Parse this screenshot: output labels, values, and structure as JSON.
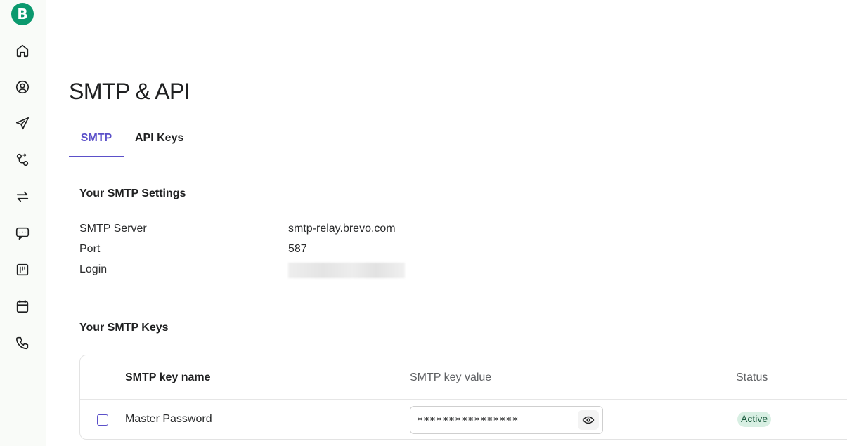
{
  "sidebar": {
    "logo_letter": "B",
    "icons": [
      "home-icon",
      "contacts-icon",
      "campaigns-icon",
      "automations-icon",
      "transactional-icon",
      "conversations-icon",
      "deals-icon",
      "meetings-icon",
      "phone-icon"
    ]
  },
  "page": {
    "title": "SMTP & API"
  },
  "tabs": [
    {
      "label": "SMTP",
      "active": true
    },
    {
      "label": "API Keys",
      "active": false
    }
  ],
  "settings": {
    "title": "Your SMTP Settings",
    "rows": [
      {
        "label": "SMTP Server",
        "value": "smtp-relay.brevo.com"
      },
      {
        "label": "Port",
        "value": "587"
      },
      {
        "label": "Login",
        "value": ""
      }
    ]
  },
  "keys": {
    "title": "Your SMTP Keys",
    "columns": [
      "SMTP key name",
      "SMTP key value",
      "Status"
    ],
    "rows": [
      {
        "name": "Master Password",
        "value": "****************",
        "status": "Active"
      }
    ]
  },
  "colors": {
    "brand": "#0b996e",
    "accent": "#5b50c9",
    "active_badge_bg": "#d8efe3"
  }
}
